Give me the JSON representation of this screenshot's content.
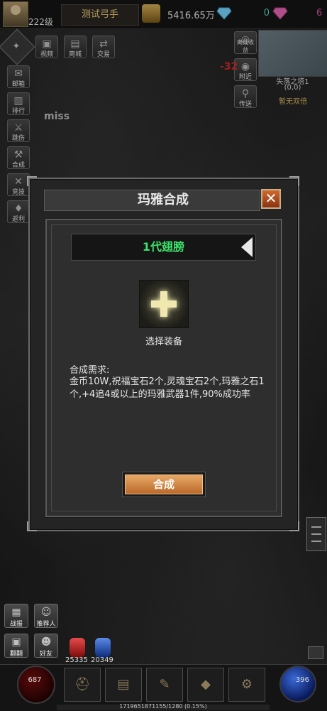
{
  "player": {
    "level": "222级",
    "name": "测试弓手"
  },
  "currency": {
    "gold": "5416.65万",
    "diamond": "0",
    "gem": "6"
  },
  "top_buttons": [
    {
      "label": "视频",
      "icon": "video-icon"
    },
    {
      "label": "商城",
      "icon": "shop-icon"
    },
    {
      "label": "交易",
      "icon": "trade-icon"
    }
  ],
  "left_menu": [
    {
      "label": "邮箱",
      "icon": "mail-icon"
    },
    {
      "label": "排行",
      "icon": "ranking-icon"
    },
    {
      "label": "跳伤",
      "icon": "damage-icon"
    },
    {
      "label": "合成",
      "icon": "craft-icon"
    },
    {
      "label": "竞技",
      "icon": "arena-icon"
    },
    {
      "label": "返利",
      "icon": "rebate-icon"
    }
  ],
  "right_top_buttons": [
    {
      "label": "离线收益",
      "icon": "offline-income-icon"
    },
    {
      "label": "附近",
      "icon": "nearby-icon"
    },
    {
      "label": "传送",
      "icon": "teleport-icon"
    }
  ],
  "map": {
    "name": "失落之塔1",
    "coord": "(0,0)",
    "double_label": "暂无双倍"
  },
  "combat": {
    "damage": "-32",
    "miss": "miss"
  },
  "modal": {
    "title": "玛雅合成",
    "close": "✕",
    "selected_item": "1代翅膀",
    "equip_label": "选择装备",
    "req_title": "合成需求:",
    "req_text": "金币10W,祝福宝石2个,灵魂宝石2个,玛雅之石1个,+4追4或以上的玛雅武器1件,90%成功率",
    "craft_button": "合成"
  },
  "bottom_left_buttons": [
    {
      "label": "战报",
      "icon": "battle-report-icon"
    },
    {
      "label": "推荐人",
      "icon": "referrer-icon"
    },
    {
      "label": "翻翻",
      "icon": "flip-icon"
    },
    {
      "label": "好友",
      "icon": "friend-icon"
    }
  ],
  "potions": {
    "hp_potion": "25335",
    "mp_potion": "20349"
  },
  "orbs": {
    "hp": "687",
    "mp": "396"
  },
  "exp_text": "1719651871155/1280 (0.15%)",
  "colors": {
    "accent_green": "#3de06a",
    "gold_text": "#f1d27a",
    "close_button": "#d0692e",
    "craft_button": "#e8a866",
    "damage_red": "#d42a2a"
  }
}
